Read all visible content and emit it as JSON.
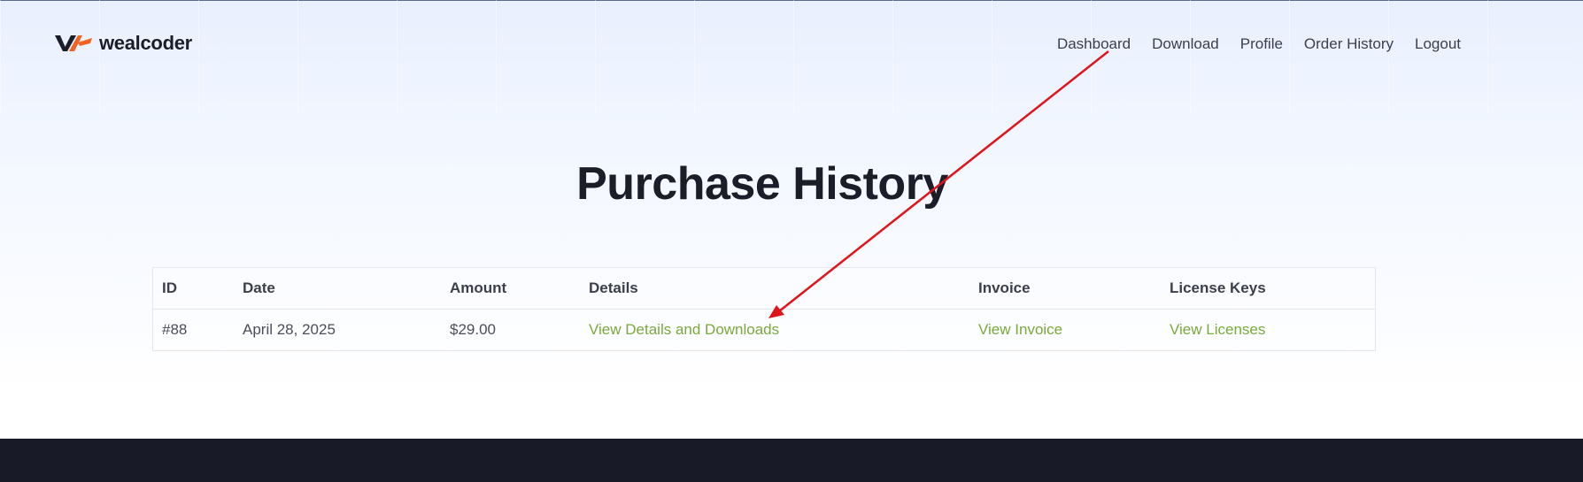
{
  "header": {
    "brand": "wealcoder",
    "nav": [
      "Dashboard",
      "Download",
      "Profile",
      "Order History",
      "Logout"
    ]
  },
  "page": {
    "title": "Purchase History"
  },
  "table": {
    "columns": [
      "ID",
      "Date",
      "Amount",
      "Details",
      "Invoice",
      "License Keys"
    ],
    "rows": [
      {
        "id": "#88",
        "date": "April 28, 2025",
        "amount": "$29.00",
        "details": "View Details and Downloads",
        "invoice": "View Invoice",
        "licenses": "View Licenses"
      }
    ]
  },
  "colors": {
    "link": "#7aa93c",
    "footer": "#181a27",
    "annotation_arrow": "#e0151b"
  },
  "icons": {
    "logo": "wealcoder-logo-icon"
  }
}
